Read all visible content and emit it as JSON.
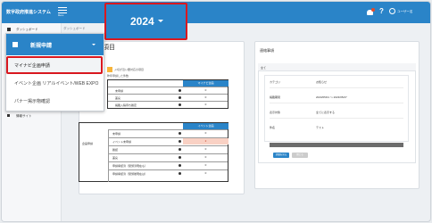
{
  "app": {
    "title": "数字政府推進システム",
    "menu_label": "Menu"
  },
  "year_selector": {
    "value": "2024"
  },
  "header": {
    "user_label": "ユーザー名",
    "help": "?"
  },
  "breadcrumb": "ダッシュボード",
  "sidebar": {
    "items": [
      {
        "label": "ダッシュボード"
      },
      {
        "label": "情報サイト"
      }
    ]
  },
  "dropdown": {
    "title": "新規申請",
    "items": [
      {
        "label": "マイナビ企画申請"
      },
      {
        "label": "イベント企画 リアルイベント/WEB EXPO"
      },
      {
        "label": "パナー掲示物確認"
      }
    ]
  },
  "main": {
    "card_title": "項目",
    "legend": "〆切が近い要対応の項目",
    "sub_note": "昨年申請した件数",
    "table1": {
      "header": "マイナビ企画",
      "rows": [
        {
          "label": "未申請",
          "value": "0"
        },
        {
          "label": "差戻",
          "value": "0"
        },
        {
          "label": "掲載入稿待ち確定",
          "value": "0"
        }
      ]
    },
    "table2": {
      "header": "イベント企画",
      "group_label": "企画申請",
      "rows": [
        {
          "label": "未申請",
          "value": "0"
        },
        {
          "label": "イベント未申請",
          "value": "2",
          "highlight": true
        },
        {
          "label": "確認",
          "value": "0"
        },
        {
          "label": "差戻",
          "value": "0"
        },
        {
          "label": "申請承認済（受領済現在も）",
          "value": "0"
        },
        {
          "label": "申請承認済（受領後現在は）",
          "value": "0"
        }
      ]
    }
  },
  "notices": {
    "title": "連絡事項",
    "header": "全て",
    "rows": [
      {
        "label": "カテゴリ",
        "value": "お知らせ"
      },
      {
        "label": "掲載期間",
        "value": "2023/05/01 ～ 2023/05/27"
      },
      {
        "label": "表示対象",
        "value": "全てに表示する"
      },
      {
        "label": "件名",
        "value": "テスト"
      }
    ],
    "buttons": {
      "primary": "詳細を見る",
      "secondary": "閉じる"
    }
  },
  "colors": {
    "brand": "#2a84c8",
    "highlight_red": "#d9181f",
    "warning_orange": "#f7b43a",
    "cell_pink": "#f9d1c4"
  }
}
